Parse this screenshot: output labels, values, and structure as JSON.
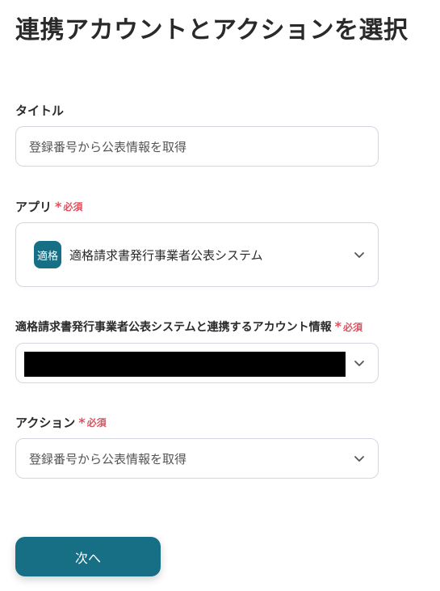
{
  "page": {
    "title": "連携アカウントとアクションを選択"
  },
  "title_field": {
    "label": "タイトル",
    "value": "登録番号から公表情報を取得"
  },
  "app_field": {
    "label": "アプリ",
    "required": "必須",
    "app_icon_text": "適格",
    "app_name": "適格請求書発行事業者公表システム"
  },
  "account_field": {
    "label": "適格請求書発行事業者公表システムと連携するアカウント情報",
    "required": "必須"
  },
  "action_field": {
    "label": "アクション",
    "required": "必須",
    "value": "登録番号から公表情報を取得"
  },
  "next_button": {
    "label": "次へ"
  },
  "colors": {
    "accent": "#176f85",
    "required": "#e0505e",
    "border": "#d4d7de"
  }
}
